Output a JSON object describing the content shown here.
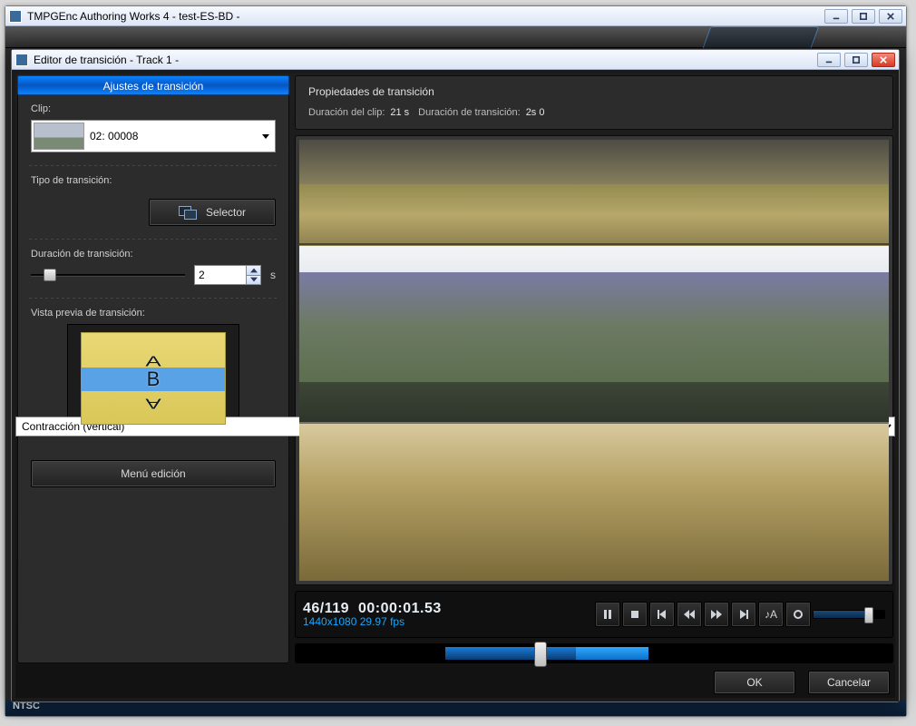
{
  "parent": {
    "title": "TMPGEnc Authoring Works 4 - test-ES-BD -",
    "status": "NTSC"
  },
  "editor": {
    "title": "Editor de transición - Track 1 -"
  },
  "sidebar": {
    "header": "Ajustes de transición",
    "clip_label": "Clip:",
    "clip_name": "02: 00008",
    "type_label": "Tipo de transición:",
    "type_value": "Contracción (vertical)",
    "selector_label": "Selector",
    "duration_label": "Duración de transición:",
    "duration_value": "2",
    "duration_unit": "s",
    "preview_label": "Vista previa de transición:",
    "menu_button": "Menú edición"
  },
  "props": {
    "title": "Propiedades de transición",
    "clip_dur_label": "Duración del clip:",
    "clip_dur_value": "21 s",
    "trans_dur_label": "Duración de transición:",
    "trans_dur_value": "2s 0"
  },
  "transport": {
    "frame": "46/119",
    "timecode": "00:00:01.53",
    "format": "1440x1080 29.97 fps",
    "audio_btn": "♪A"
  },
  "dialog": {
    "ok": "OK",
    "cancel": "Cancelar"
  }
}
